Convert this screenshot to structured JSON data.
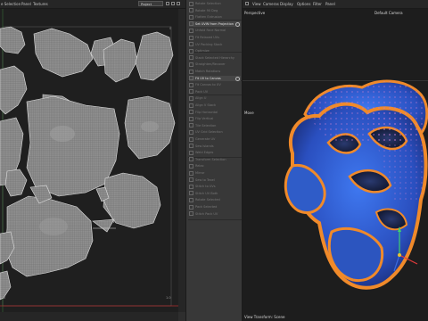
{
  "uv_editor": {
    "menu": [
      "e Selection",
      "Panel",
      "Textures"
    ],
    "project_select": "Project",
    "ruler_top": "0",
    "ruler_bottom_left": "0",
    "ruler_bottom_right": "1.0",
    "ruler_right_bottom": "1.0"
  },
  "middle_panel": {
    "rows": [
      {
        "label": "Rotate Selection",
        "active": false
      },
      {
        "label": "Rotate 90 Deg",
        "active": false
      },
      {
        "label": "Flatten Extrusion",
        "active": false
      },
      {
        "label": "Set UVW from Projection",
        "active": true
      },
      {
        "label": "Unfold Face Normal",
        "active": false
      },
      {
        "label": "Fit Relaxed UVs",
        "active": false
      },
      {
        "label": "UV Packing Stack",
        "active": false
      },
      {
        "label": "Optimize",
        "active": false
      },
      {
        "label": "Stack Selected Hierarchy",
        "active": false
      },
      {
        "label": "Straighten/Recover",
        "active": false
      },
      {
        "label": "Match Rotations",
        "active": false
      },
      {
        "label": "Fit UV to Canvas",
        "active": true
      },
      {
        "label": "Fit Canvas to UV",
        "active": false
      },
      {
        "label": "Pack UV",
        "active": false
      },
      {
        "label": "Align U",
        "active": false
      },
      {
        "label": "Align V Stack",
        "active": false
      },
      {
        "label": "Flip Horizontal",
        "active": false
      },
      {
        "label": "Flip Vertical",
        "active": false
      },
      {
        "label": "Tile Selection",
        "active": false
      },
      {
        "label": "UV Grid Selection",
        "active": false
      },
      {
        "label": "Generate UV",
        "active": false
      },
      {
        "label": "Sew Islands",
        "active": false
      },
      {
        "label": "Weld Edges",
        "active": false
      },
      {
        "label": "Transform Selection",
        "active": false
      },
      {
        "label": "Relax",
        "active": false
      },
      {
        "label": "Mirror",
        "active": false
      },
      {
        "label": "Sew to Texel",
        "active": false
      },
      {
        "label": "Stitch to UVs",
        "active": false
      },
      {
        "label": "Stitch UV Both",
        "active": false
      },
      {
        "label": "Rotate Selected",
        "active": false
      },
      {
        "label": "Pack Selected",
        "active": false
      },
      {
        "label": "Stitch Pack UV",
        "active": false
      }
    ]
  },
  "viewport": {
    "menu": [
      "View",
      "Cameras",
      "Display",
      "Options",
      "Filter",
      "Panel"
    ],
    "projection_label": "Perspective",
    "camera_label": "Default Camera",
    "move_label": "Move",
    "status_label": "View Transform: Scene"
  },
  "colors": {
    "uv_wire": "#d0d0d0",
    "object_blue": "#2e5fd0",
    "object_orange": "#f08a2a",
    "accent_red": "#b03030"
  }
}
